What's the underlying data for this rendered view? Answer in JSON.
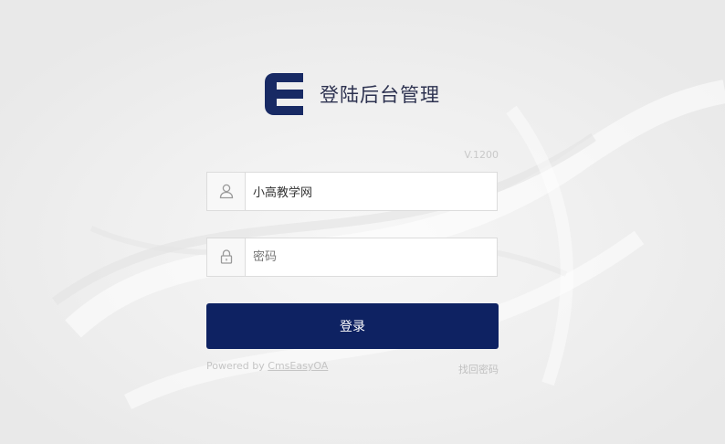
{
  "header": {
    "title": "登陆后台管理",
    "logo_icon": "cmseasy-e-logo-icon"
  },
  "version": "V.1200",
  "form": {
    "username": {
      "icon": "user-icon",
      "value": "小高教学网",
      "placeholder": ""
    },
    "password": {
      "icon": "lock-icon",
      "value": "",
      "placeholder": "密码"
    },
    "submit_label": "登录"
  },
  "footer": {
    "powered_prefix": "Powered by ",
    "powered_link": "CmsEasyOA",
    "forgot_label": "找回密码"
  },
  "colors": {
    "primary": "#0e2262",
    "title_text": "#2d3250",
    "background": "#efefef"
  }
}
